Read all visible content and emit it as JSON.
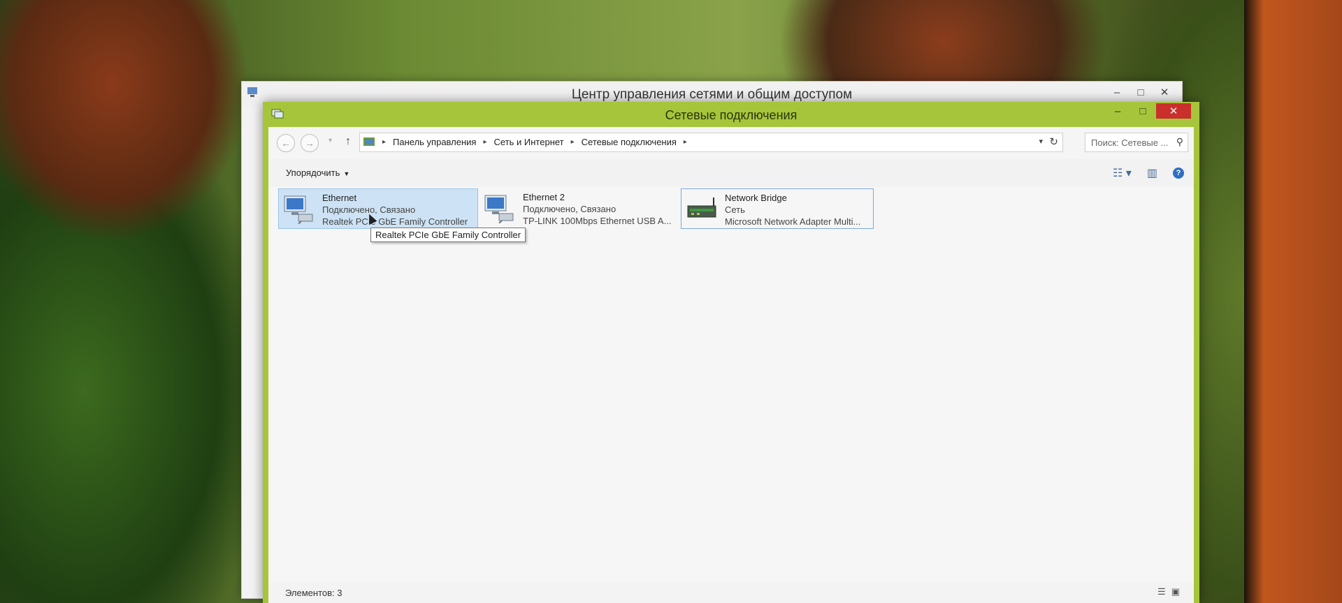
{
  "back_window": {
    "title": "Центр управления сетями и общим доступом",
    "controls": {
      "minimize": "–",
      "maximize": "□",
      "close": "✕"
    }
  },
  "window": {
    "title": "Сетевые подключения",
    "controls": {
      "minimize": "–",
      "maximize": "□",
      "close": "✕"
    },
    "accent_color": "#a7c53a"
  },
  "navigation": {
    "back": "←",
    "forward": "→",
    "up": "↑",
    "breadcrumb": [
      "Панель управления",
      "Сеть и Интернет",
      "Сетевые подключения"
    ],
    "search_placeholder": "Поиск: Сетевые ..."
  },
  "toolbar": {
    "organize_label": "Упорядочить",
    "view_icon": "view-options-icon",
    "preview_icon": "preview-pane-icon",
    "help_icon": "help-icon"
  },
  "connections": [
    {
      "name": "Ethernet",
      "status": "Подключено, Связано",
      "device": "Realtek PCIe GbE Family Controller",
      "icon": "network-adapter-icon"
    },
    {
      "name": "Ethernet 2",
      "status": "Подключено, Связано",
      "device": "TP-LINK 100Mbps Ethernet USB A...",
      "icon": "network-adapter-icon"
    },
    {
      "name": "Network Bridge",
      "status": "Сеть",
      "device": "Microsoft Network Adapter Multi...",
      "icon": "network-bridge-icon"
    }
  ],
  "tooltip": "Realtek PCIe GbE Family Controller",
  "status_bar": {
    "items_count": "Элементов: 3"
  }
}
